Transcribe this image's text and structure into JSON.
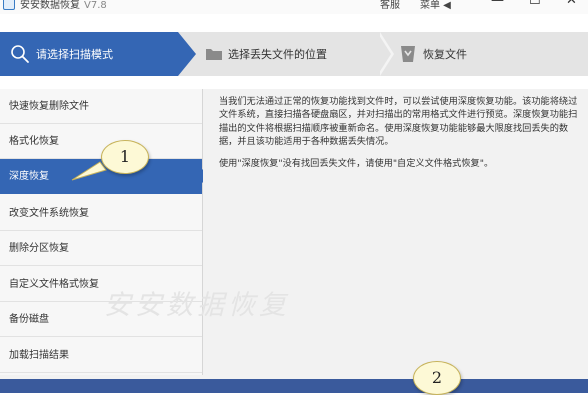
{
  "titlebar": {
    "app_name": "安安数据恢复",
    "version": "V7.8",
    "service": "客服",
    "menu": "菜单 ◀",
    "minimize": "—",
    "maximize": "☐",
    "close": "✕"
  },
  "steps": [
    {
      "label": "请选择扫描模式",
      "active": true
    },
    {
      "label": "选择丢失文件的位置",
      "active": false
    },
    {
      "label": "恢复文件",
      "active": false
    }
  ],
  "colors": {
    "accent": "#3466b4",
    "bottom_bar": "#3a5a9c",
    "callout": "#fdf9d6"
  },
  "sidebar": {
    "items": [
      {
        "label": "快速恢复删除文件"
      },
      {
        "label": "格式化恢复"
      },
      {
        "label": "深度恢复",
        "selected": true
      },
      {
        "label": "改变文件系统恢复"
      },
      {
        "label": "删除分区恢复"
      },
      {
        "label": "自定义文件格式恢复"
      },
      {
        "label": "备份磁盘"
      },
      {
        "label": "加载扫描结果"
      }
    ]
  },
  "content": {
    "description": "当我们无法通过正常的恢复功能找到文件时，可以尝试使用深度恢复功能。该功能将绕过文件系统，直接扫描各硬盘扇区，并对扫描出的常用格式文件进行预览。深度恢复功能扫描出的文件将根据扫描顺序被重新命名。使用深度恢复功能能够最大限度找回丢失的数据，并且该功能适用于各种数据丢失情况。",
    "hint": "使用\"深度恢复\"没有找回丢失文件，请使用\"自定义文件格式恢复\"。",
    "watermark": "安安数据恢复"
  },
  "callouts": [
    {
      "number": "1"
    },
    {
      "number": "2"
    }
  ]
}
